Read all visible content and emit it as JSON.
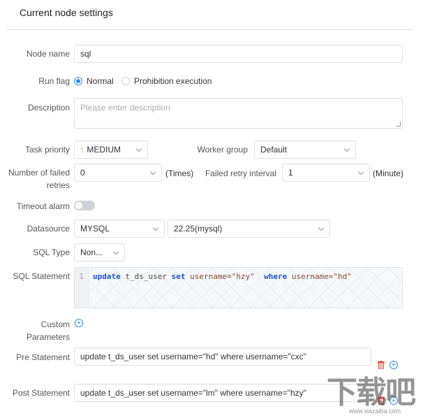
{
  "header": {
    "title": "Current node settings"
  },
  "fields": {
    "node_name": {
      "label": "Node name",
      "value": "sql"
    },
    "run_flag": {
      "label": "Run flag",
      "options": [
        "Normal",
        "Prohibition execution"
      ],
      "selected": "Normal"
    },
    "description": {
      "label": "Description",
      "placeholder": "Please enter description"
    },
    "task_priority": {
      "label": "Task priority",
      "value": "MEDIUM",
      "arrow": "↑"
    },
    "worker_group": {
      "label": "Worker group",
      "value": "Default"
    },
    "failed_retries": {
      "label_line1": "Number of failed",
      "label_line2": "retries",
      "value": "0",
      "unit": "(Times)"
    },
    "retry_interval": {
      "label": "Failed retry interval",
      "value": "1",
      "unit": "(Minute)"
    },
    "timeout_alarm": {
      "label": "Timeout alarm",
      "enabled": false
    },
    "datasource": {
      "label": "Datasource",
      "type": "MYSQL",
      "value": "22.25(mysql)"
    },
    "sql_type": {
      "label": "SQL Type",
      "value": "Non..."
    },
    "sql_statement": {
      "label": "SQL Statement",
      "line_number": "1",
      "tokens": [
        "update",
        " t_ds_user ",
        "set",
        " username=\"hzy\"  ",
        "where",
        " username=\"hd\""
      ]
    },
    "custom_parameters": {
      "label_line1": "Custom",
      "label_line2": "Parameters"
    },
    "pre_statement": {
      "label": "Pre Statement",
      "value": "update t_ds_user set username=\"hd\"  where username=\"cxc\""
    },
    "post_statement": {
      "label": "Post Statement",
      "value": "update t_ds_user set username=\"lm\"  where username=\"hzy\""
    }
  },
  "colors": {
    "accent": "#2d8cf0",
    "danger": "#e0453a",
    "priority_arrow": "#f5792a"
  },
  "watermark": {
    "text": "下载吧",
    "sub": "www.xiazaiba.com"
  }
}
